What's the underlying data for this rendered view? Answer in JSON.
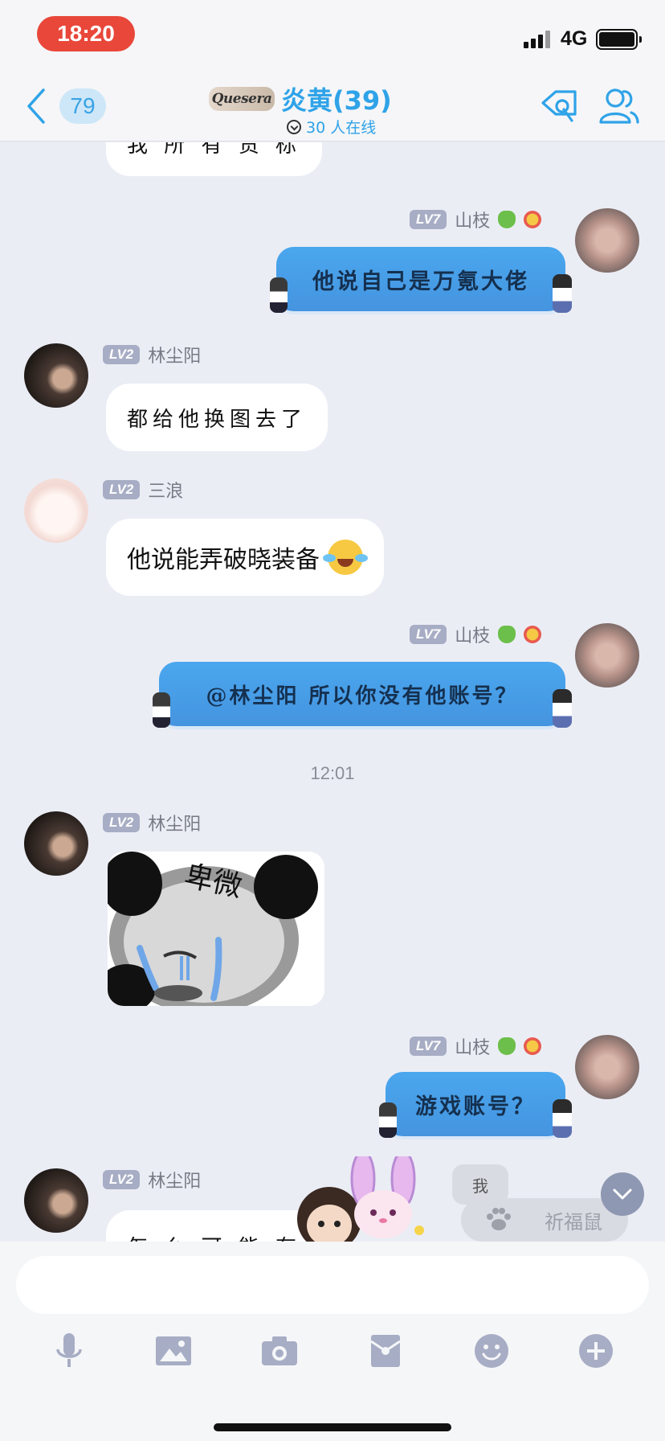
{
  "status_bar": {
    "time": "18:20",
    "network": "4G"
  },
  "header": {
    "unread_count": "79",
    "group_logo_text": "Quesera",
    "group_title": "炎黄(39)",
    "online_text": "30 人在线"
  },
  "messages": [
    {
      "side": "left",
      "text": "我 所 有 贯 标",
      "partial": true
    },
    {
      "side": "right",
      "level": "LV7",
      "username": "山枝",
      "text": "他说自己是万氪大佬",
      "style": "theme-bubble"
    },
    {
      "side": "left",
      "level": "LV2",
      "username": "林尘阳",
      "text": "都给他换图去了"
    },
    {
      "side": "left",
      "level": "LV2",
      "username": "三浪",
      "text": "他说能弄破晓装备",
      "emoji": "laughing-crying-icon"
    },
    {
      "side": "right",
      "level": "LV7",
      "username": "山枝",
      "text": "@林尘阳 所以你没有他账号？",
      "style": "theme-bubble"
    },
    {
      "type": "timestamp",
      "text": "12:01"
    },
    {
      "side": "left",
      "level": "LV2",
      "username": "林尘阳",
      "type": "sticker",
      "sticker_text": "卑微"
    },
    {
      "side": "right",
      "level": "LV7",
      "username": "山枝",
      "text": "游戏账号？",
      "style": "theme-bubble"
    },
    {
      "side": "left",
      "level": "LV2",
      "username": "林尘阳",
      "text": "怎 么 可 能 有",
      "partial": true
    }
  ],
  "floating": {
    "me_label": "我",
    "pet_name": "祈福鼠"
  },
  "input": {
    "placeholder": ""
  },
  "toolbar": [
    "microphone-icon",
    "image-icon",
    "camera-icon",
    "red-packet-icon",
    "emoji-icon",
    "plus-icon"
  ],
  "colors": {
    "accent": "#2fa3e8",
    "blue_bubble": "#4aa7ee",
    "time_pill": "#e8473a",
    "level_badge": "#a7adc4"
  }
}
